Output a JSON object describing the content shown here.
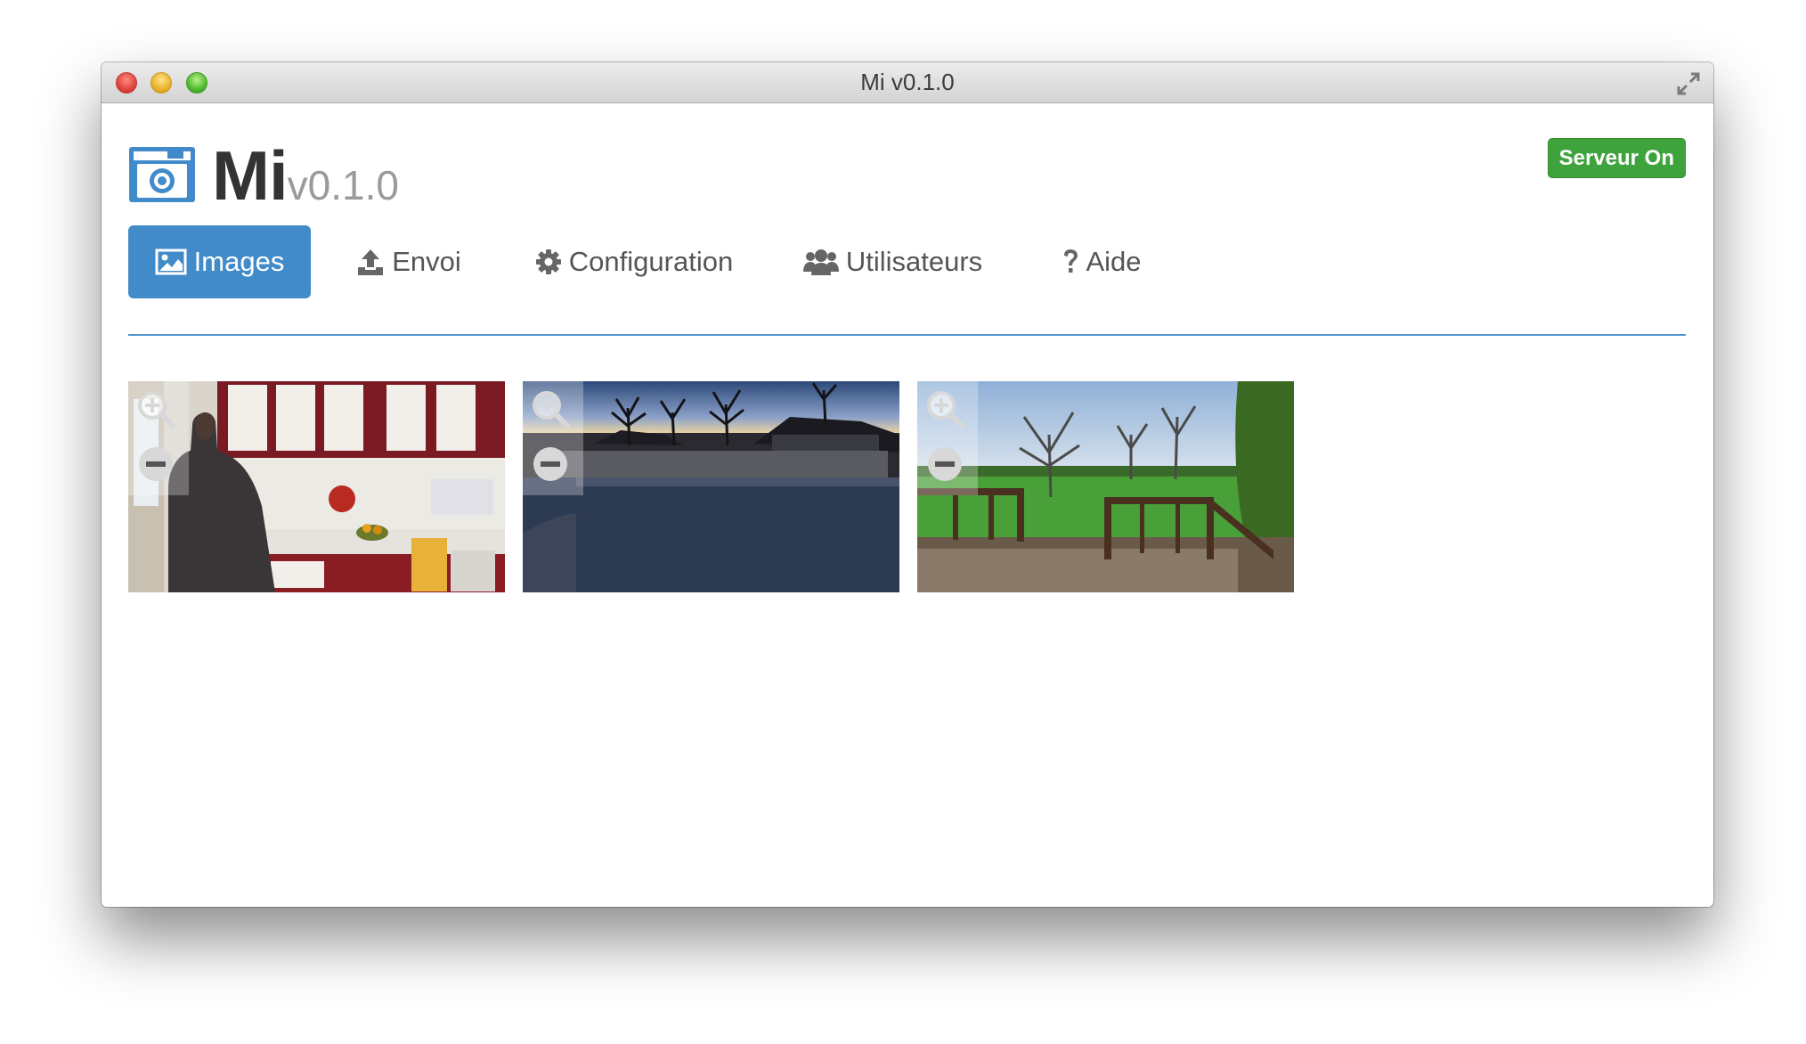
{
  "window": {
    "title": "Mi v0.1.0"
  },
  "header": {
    "app_name": "Mi",
    "version": "v0.1.0",
    "server_status": "Serveur On"
  },
  "nav": {
    "tabs": [
      {
        "label": "Images",
        "icon": "image-icon",
        "active": true
      },
      {
        "label": "Envoi",
        "icon": "upload-icon",
        "active": false
      },
      {
        "label": "Configuration",
        "icon": "gear-icon",
        "active": false
      },
      {
        "label": "Utilisateurs",
        "icon": "users-icon",
        "active": false
      },
      {
        "label": "Aide",
        "icon": "question-icon",
        "active": false
      }
    ]
  },
  "gallery": {
    "images": [
      {
        "subject": "kitchen"
      },
      {
        "subject": "street-sunset"
      },
      {
        "subject": "garden-deck"
      }
    ]
  },
  "colors": {
    "accent": "#428bca",
    "status": "#3fa33d"
  }
}
